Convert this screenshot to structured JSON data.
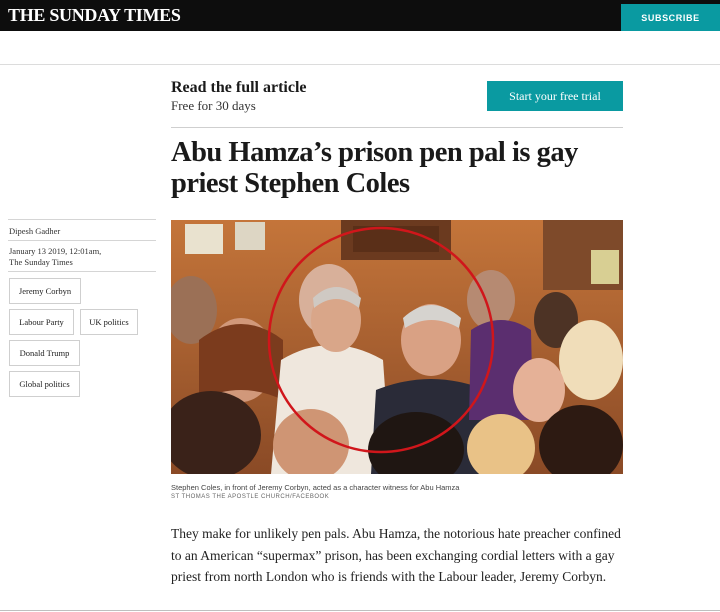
{
  "header": {
    "masthead": "THE SUNDAY TIMES",
    "subscribe_label": "SUBSCRIBE"
  },
  "promo": {
    "title": "Read the full article",
    "subtitle": "Free for 30 days",
    "button_label": "Start your free trial"
  },
  "article": {
    "headline": "Abu Hamza’s prison pen pal is gay priest Stephen Coles",
    "author": "Dipesh Gadher",
    "date": "January 13 2019, 12:01am,",
    "publication": "The Sunday Times",
    "tags": [
      "Jeremy Corbyn",
      "Labour Party",
      "UK politics",
      "Donald Trump",
      "Global politics"
    ],
    "image_caption": "Stephen Coles, in front of Jeremy Corbyn, acted as a character witness for Abu Hamza",
    "image_credit": "ST THOMAS THE APOSTLE CHURCH/FACEBOOK",
    "body": "They make for unlikely pen pals. Abu Hamza, the notorious hate preacher confined to an American “supermax” prison, has been exchanging cordial letters with a gay priest from north London who is friends with the Labour leader, Jeremy Corbyn."
  },
  "colors": {
    "header_bg": "#0d0d0d",
    "accent_teal": "#0a9aa1",
    "highlight_circle": "#d0161b"
  }
}
